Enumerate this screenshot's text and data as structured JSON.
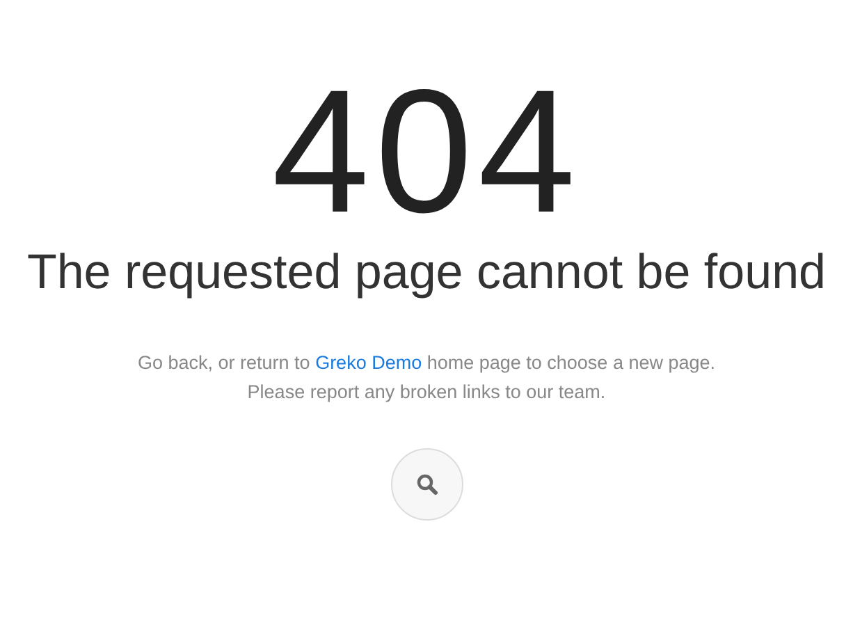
{
  "error_code": "404",
  "heading": "The requested page cannot be found",
  "message": {
    "before": "Go back, or return to",
    "link": "Greko Demo",
    "after": "home page to choose a new page."
  },
  "note": "Please report any broken links to our team."
}
